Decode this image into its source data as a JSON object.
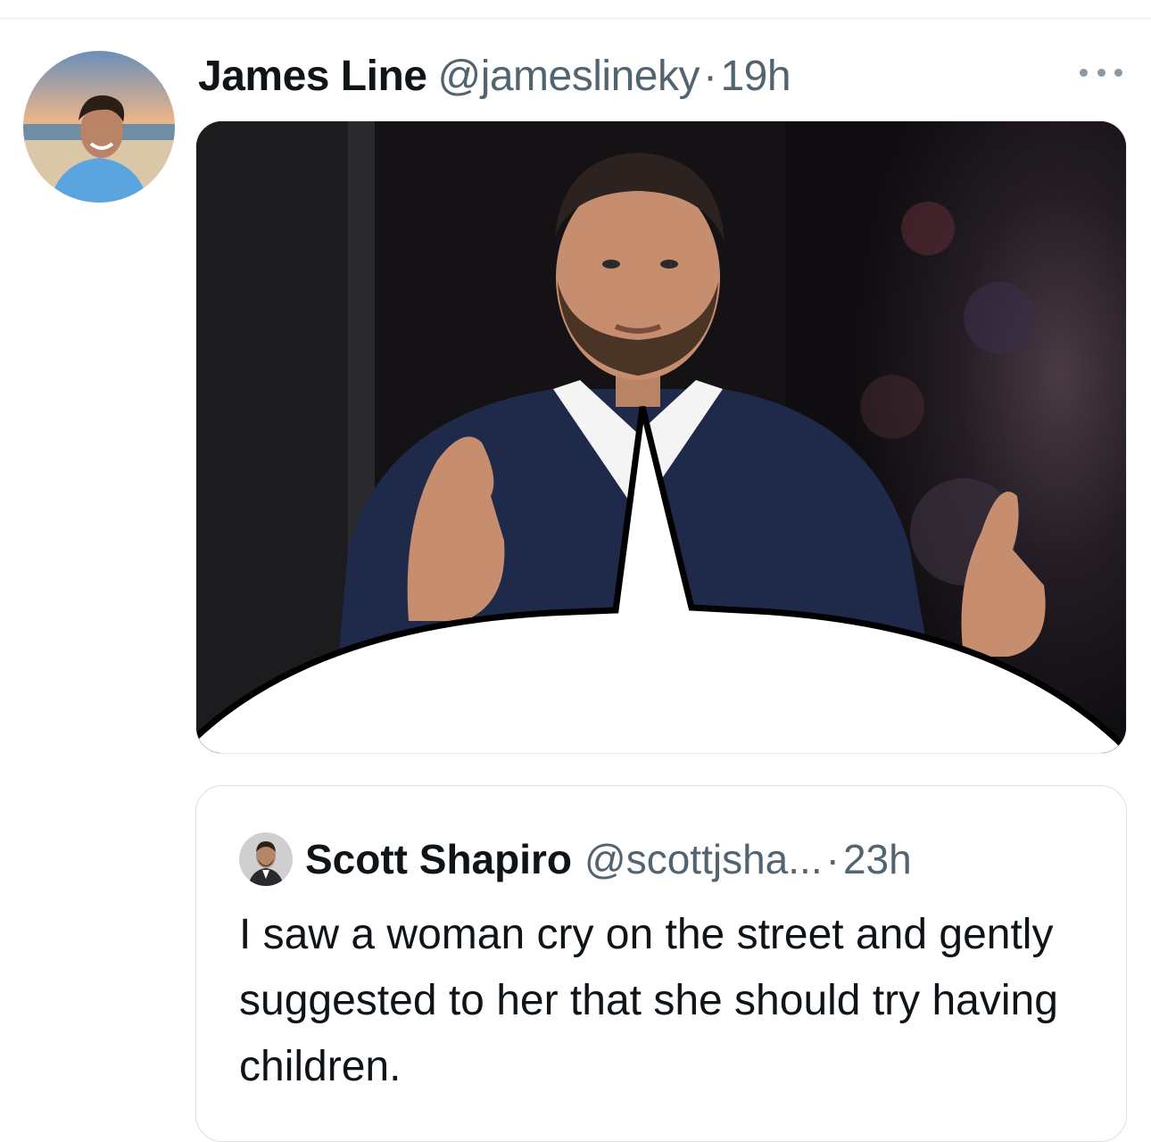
{
  "tweet": {
    "author_name": "James Line",
    "author_handle": "@jameslineky",
    "separator": "·",
    "time": "19h",
    "more_icon": "more-icon",
    "avatar_icon": "avatar-photo"
  },
  "media": {
    "description_icon": "photo-with-speech-bubble"
  },
  "quote": {
    "author_name": "Scott Shapiro",
    "author_handle": "@scottjsha...",
    "separator": "·",
    "time": "23h",
    "text": "I saw a woman cry on the street and gently suggested to her that she should try having children."
  },
  "colors": {
    "text_primary": "#0f1419",
    "text_secondary": "#536471",
    "border": "#dbe0e4"
  }
}
